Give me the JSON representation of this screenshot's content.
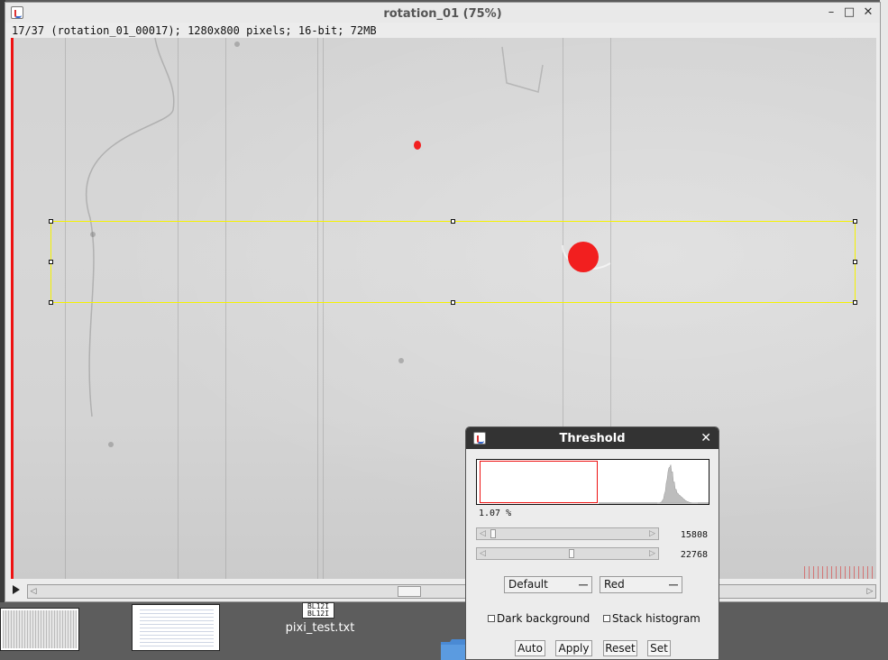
{
  "image_window": {
    "title": "rotation_01 (75%)",
    "info": "17/37 (rotation_01_00017); 1280x800 pixels; 16-bit; 72MB",
    "minimize_glyph": "–",
    "maximize_glyph": "□",
    "close_glyph": "✕",
    "icon": "java-icon",
    "overlay_color": "#f21f1f",
    "roi_color": "#f5f200"
  },
  "desktop": {
    "file_icon_text": "BL12I",
    "file_label": "pixi_test.txt",
    "folder_color": "#4a8ad4"
  },
  "threshold": {
    "title": "Threshold",
    "close_glyph": "✕",
    "percent": "1.07 %",
    "slider1_value": "15808",
    "slider2_value": "22768",
    "method": "Default",
    "display": "Red",
    "dark_background_label": "Dark background",
    "stack_histogram_label": "Stack histogram",
    "buttons": {
      "auto": "Auto",
      "apply": "Apply",
      "reset": "Reset",
      "set": "Set"
    }
  }
}
